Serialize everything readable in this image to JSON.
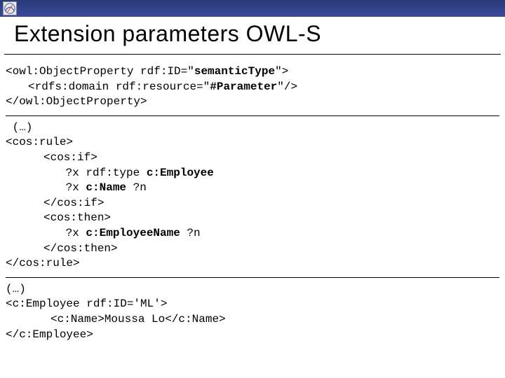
{
  "title": "Extension parameters OWL-S",
  "block1": {
    "l1a": "<owl:ObjectProperty rdf:ID=\"",
    "l1b": "semanticType",
    "l1c": "\">",
    "l2a": "<rdfs:domain rdf:resource=\"",
    "l2b": "#Parameter",
    "l2c": "\"/>",
    "l3": "</owl:ObjectProperty>"
  },
  "block2": {
    "ell": " (…)",
    "l1": "<cos:rule>",
    "l2": "<cos:if>",
    "l3a": " ?x rdf:type ",
    "l3b": "c:Employee",
    "l4a": " ?x ",
    "l4b": "c:Name",
    "l4c": " ?n",
    "l5": "</cos:if>",
    "l6": "<cos:then>",
    "l7a": " ?x ",
    "l7b": "c:EmployeeName",
    "l7c": " ?n",
    "l8": "</cos:then>",
    "l9": "</cos:rule>"
  },
  "block3": {
    "ell": "(…)",
    "l1": "<c:Employee rdf:ID='ML'>",
    "l2": "<c:Name>Moussa Lo</c:Name>",
    "l3": "</c:Employee>"
  }
}
